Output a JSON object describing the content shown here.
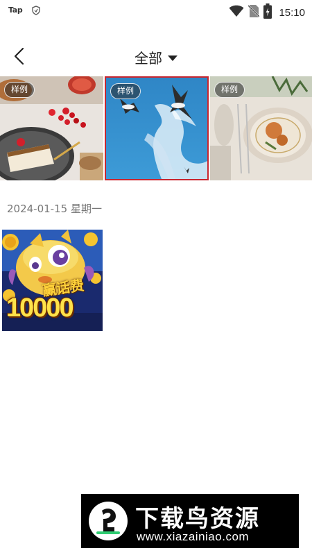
{
  "status_bar": {
    "app_logo": "Tap",
    "time": "15:10",
    "icons": [
      "shield-icon",
      "wifi-icon",
      "no-sim-icon",
      "battery-icon"
    ]
  },
  "header": {
    "title": "全部",
    "back_icon": "back-arrow-icon",
    "dropdown_icon": "caret-down-icon"
  },
  "samples": [
    {
      "badge": "样例",
      "subject": "dessert table"
    },
    {
      "badge": "样例",
      "subject": "seagulls in sky",
      "selected": true
    },
    {
      "badge": "样例",
      "subject": "dining table"
    }
  ],
  "gallery": {
    "date": "2024-01-15 星期一",
    "items": [
      {
        "text_line_1": "赢话费",
        "text_line_2": "10000"
      }
    ]
  },
  "watermark": {
    "title": "下载鸟资源",
    "url": "www.xiazainiao.com"
  },
  "colors": {
    "selection_border": "#c8262f",
    "badge_bg": "rgba(40,40,40,0.55)",
    "date_text": "#777777"
  }
}
